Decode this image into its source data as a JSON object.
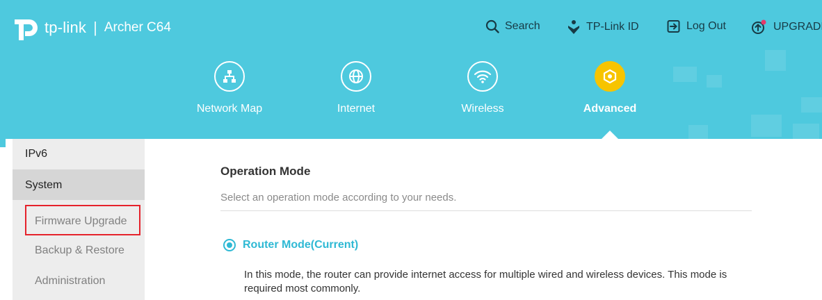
{
  "brand": {
    "logo_text": "tp-link",
    "separator": "|",
    "model": "Archer C64"
  },
  "top_links": {
    "search": "Search",
    "tplink_id": "TP-Link ID",
    "logout": "Log Out",
    "upgrade": "UPGRADE"
  },
  "nav": {
    "items": [
      {
        "label": "Network Map",
        "icon": "network-map-icon"
      },
      {
        "label": "Internet",
        "icon": "globe-icon"
      },
      {
        "label": "Wireless",
        "icon": "wifi-icon"
      },
      {
        "label": "Advanced",
        "icon": "gear-icon",
        "active": true
      }
    ]
  },
  "sidebar": {
    "top_item": "IPv6",
    "section": "System",
    "sub_items": [
      "Firmware Upgrade",
      "Backup & Restore",
      "Administration"
    ],
    "highlighted": "Firmware Upgrade"
  },
  "main": {
    "title": "Operation Mode",
    "description": "Select an operation mode according to your needs.",
    "mode": {
      "label": "Router Mode(Current)",
      "selected": true,
      "description": "In this mode, the router can provide internet access for multiple wired and wireless devices. This mode is required most commonly."
    }
  },
  "colors": {
    "header_bg": "#4ec9de",
    "accent": "#2fb9d4",
    "active_nav": "#f7c400",
    "highlight_box": "#e5222b",
    "sidebar_bg": "#ededed",
    "sidebar_active_bg": "#d6d6d6"
  }
}
